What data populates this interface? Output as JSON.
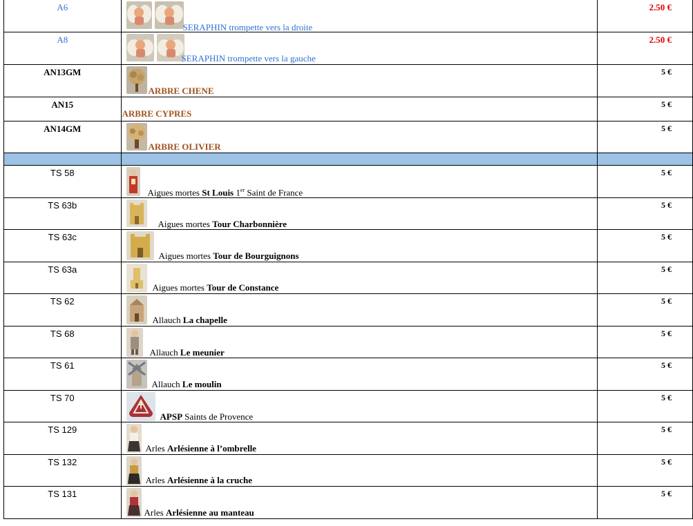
{
  "rows": [
    {
      "code": "A6",
      "price": "2.50 €",
      "desc": "SERAPHIN trompette vers la droite"
    },
    {
      "code": "A8",
      "price": "2.50 €",
      "desc": "SERAPHIN trompette vers la gauche"
    },
    {
      "code": "AN13GM",
      "price": "5 €",
      "desc": "ARBRE CHENE"
    },
    {
      "code": "AN15",
      "price": "5 €",
      "desc": "ARBRE CYPRES"
    },
    {
      "code": "AN14GM",
      "price": "5 €",
      "desc": "ARBRE OLIVIER"
    },
    {
      "code": "TS 58",
      "price": "5 €",
      "place": "Aigues mortes ",
      "name": "St Louis",
      "sup": "er",
      "rest": " Saint de France",
      "one": " 1"
    },
    {
      "code": "TS 63b",
      "price": "5 €",
      "place": "Aigues mortes ",
      "name": "Tour Charbonnière"
    },
    {
      "code": "TS 63c",
      "price": "5 €",
      "place": "Aigues mortes ",
      "name": "Tour de Bourguignons"
    },
    {
      "code": "TS 63a",
      "price": "5 €",
      "place": "Aigues mortes ",
      "name": "Tour de Constance"
    },
    {
      "code": "TS 62",
      "price": "5 €",
      "place": "Allauch ",
      "name": "La chapelle"
    },
    {
      "code": "TS 68",
      "price": "5 €",
      "place": "Allauch ",
      "name": "Le meunier"
    },
    {
      "code": "TS 61",
      "price": "5 €",
      "place": "Allauch ",
      "name": "Le moulin"
    },
    {
      "code": "TS 70",
      "price": "5 €",
      "place": "APSP",
      "name": " Saints de Provence"
    },
    {
      "code": "TS 129",
      "price": "5 €",
      "place": "Arles ",
      "name": "Arlésienne à l’ombrelle"
    },
    {
      "code": "TS 132",
      "price": "5 €",
      "place": "Arles ",
      "name": "Arlésienne à la cruche"
    },
    {
      "code": "TS 131",
      "price": "5 €",
      "place": "Arles ",
      "name": "Arlésienne au manteau"
    }
  ],
  "colors": {
    "link_blue": "#2f6fd6",
    "price_red": "#e00000",
    "tree_brown": "#a0521e",
    "separator": "#9cc2e5"
  }
}
